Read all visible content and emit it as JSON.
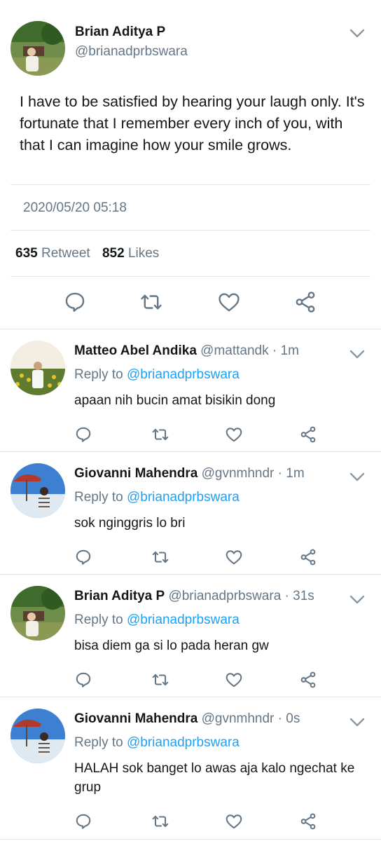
{
  "main_tweet": {
    "name": "Brian Aditya P",
    "handle": "@brianadprbswara",
    "text": "I have to be satisfied by hearing your laugh only. It's fortunate that I remember every inch of you, with that I can imagine how your smile grows.",
    "datetime": "2020/05/20 05:18",
    "retweet_count": "635",
    "retweet_label": "Retweet",
    "like_count": "852",
    "like_label": "Likes"
  },
  "replies": [
    {
      "name": "Matteo Abel Andika",
      "handle_time": "@mattandk · 1m",
      "reply_prefix": "Reply to",
      "reply_to": "@brianadprbswara",
      "text": "apaan nih bucin amat bisikin dong"
    },
    {
      "name": "Giovanni Mahendra",
      "handle_time": "@gvnmhndr · 1m",
      "reply_prefix": "Reply to",
      "reply_to": "@brianadprbswara",
      "text": "sok nginggris lo bri"
    },
    {
      "name": "Brian Aditya P",
      "handle_time": "@brianadprbswara · 31s",
      "reply_prefix": "Reply to",
      "reply_to": "@brianadprbswara",
      "text": "bisa diem ga si lo pada heran gw"
    },
    {
      "name": "Giovanni Mahendra",
      "handle_time": "@gvnmhndr · 0s",
      "reply_prefix": "Reply to",
      "reply_to": "@brianadprbswara",
      "text": "HALAH sok banget lo awas aja kalo ngechat ke grup"
    }
  ],
  "icons": {
    "action_color": "#657786",
    "mention_color": "#1da1f2",
    "actions": [
      "reply-icon",
      "retweet-icon",
      "like-icon",
      "share-icon"
    ],
    "chevron": "chevron-down-icon"
  }
}
